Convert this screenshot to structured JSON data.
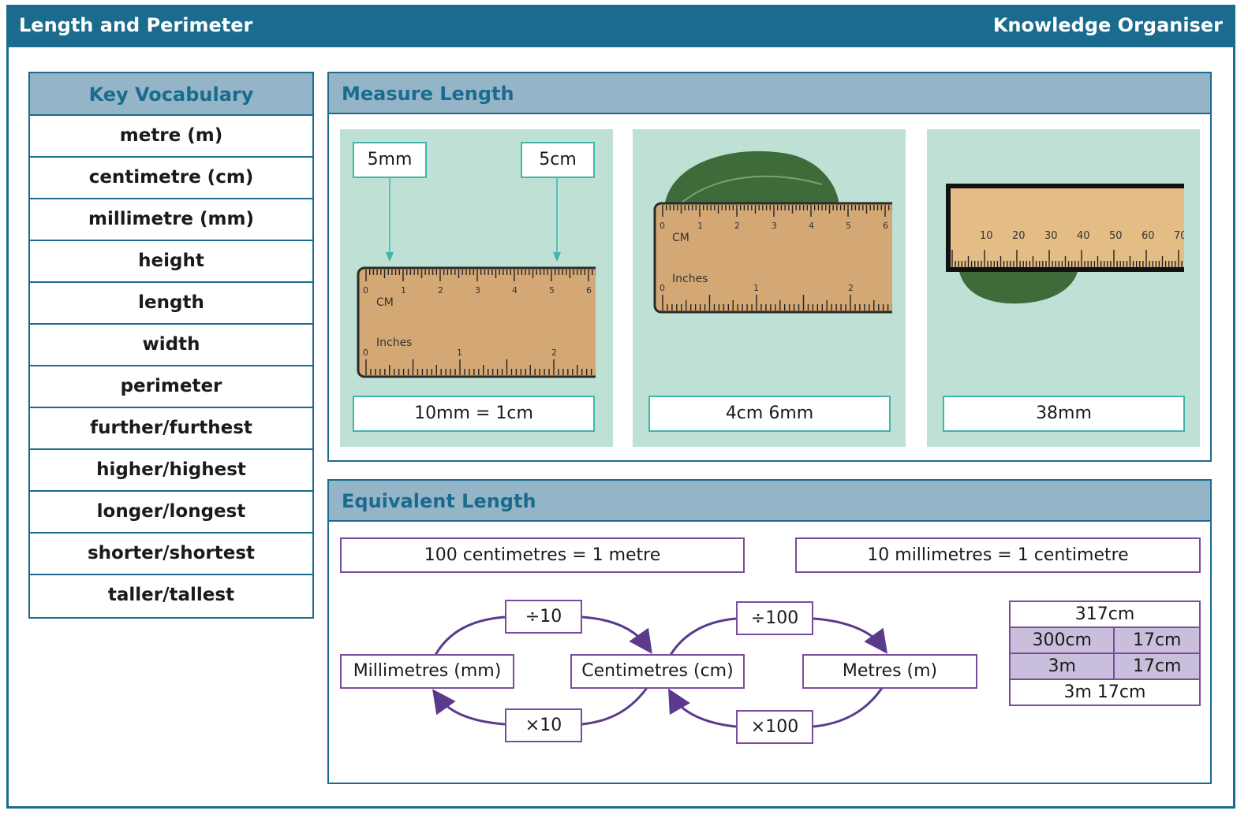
{
  "header": {
    "title": "Length and Perimeter",
    "subtitle": "Knowledge Organiser"
  },
  "vocabulary": {
    "heading": "Key Vocabulary",
    "items": [
      "metre (m)",
      "centimetre (cm)",
      "millimetre (mm)",
      "height",
      "length",
      "width",
      "perimeter",
      "further/furthest",
      "higher/highest",
      "longer/longest",
      "shorter/shortest",
      "taller/tallest"
    ]
  },
  "measure": {
    "heading": "Measure Length",
    "cards": [
      {
        "labels": [
          "5mm",
          "5cm"
        ],
        "ruler_cm": "CM",
        "ruler_in": "Inches",
        "cm_ticks": [
          "0",
          "1",
          "2",
          "3",
          "4",
          "5",
          "6"
        ],
        "in_ticks": [
          "0",
          "1",
          "2"
        ],
        "caption": "10mm = 1cm"
      },
      {
        "ruler_cm": "CM",
        "ruler_in": "Inches",
        "cm_ticks": [
          "0",
          "1",
          "2",
          "3",
          "4",
          "5",
          "6"
        ],
        "in_ticks": [
          "0",
          "1",
          "2"
        ],
        "caption": "4cm 6mm"
      },
      {
        "mm_ticks": [
          "10",
          "20",
          "30",
          "40",
          "50",
          "60",
          "70"
        ],
        "caption": "38mm"
      }
    ]
  },
  "equivalent": {
    "heading": "Equivalent Length",
    "facts": [
      "100 centimetres = 1 metre",
      "10 millimetres = 1 centimetre"
    ],
    "units": [
      "Millimetres (mm)",
      "Centimetres (cm)",
      "Metres (m)"
    ],
    "ops": {
      "div10": "÷10",
      "mul10": "×10",
      "div100": "÷100",
      "mul100": "×100"
    },
    "table": {
      "top": "317cm",
      "row1": [
        "300cm",
        "17cm"
      ],
      "row2": [
        "3m",
        "17cm"
      ],
      "bottom": "3m 17cm"
    }
  },
  "colors": {
    "brand": "#1a6b8e",
    "header_fill": "#94b4c8",
    "card_fill": "#bfe0d4",
    "teal": "#3fb5ac",
    "purple": "#7b4c9c",
    "purple_fill": "#c9bedb"
  }
}
